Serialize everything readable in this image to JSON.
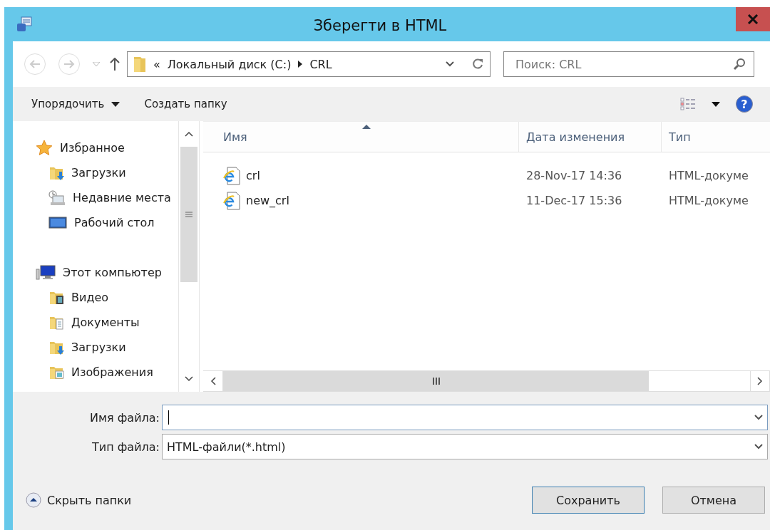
{
  "window": {
    "title": "Зберегти в HTML"
  },
  "address": {
    "overflow": "«",
    "crumbs": [
      "Локальный диск (C:)",
      "CRL"
    ]
  },
  "search": {
    "placeholder": "Поиск: CRL"
  },
  "toolbar": {
    "organize": "Упорядочить",
    "new_folder": "Создать папку",
    "help": "?"
  },
  "nav": [
    {
      "label": "Избранное",
      "kind": "favorites",
      "children": [
        {
          "label": "Загрузки",
          "kind": "downloads"
        },
        {
          "label": "Недавние места",
          "kind": "recent"
        },
        {
          "label": "Рабочий стол",
          "kind": "desktop"
        }
      ]
    },
    {
      "label": "Этот компьютер",
      "kind": "computer",
      "children": [
        {
          "label": "Видео",
          "kind": "video"
        },
        {
          "label": "Документы",
          "kind": "documents"
        },
        {
          "label": "Загрузки",
          "kind": "downloads"
        },
        {
          "label": "Изображения",
          "kind": "pictures"
        }
      ]
    }
  ],
  "table": {
    "columns": [
      "Имя",
      "Дата изменения",
      "Тип"
    ],
    "rows": [
      {
        "name": "crl",
        "date": "28-Nov-17 14:36",
        "type": "HTML-докуме"
      },
      {
        "name": "new_crl",
        "date": "11-Dec-17 15:36",
        "type": "HTML-докуме"
      }
    ]
  },
  "file_name": {
    "label": "Имя файла:"
  },
  "file_type": {
    "label": "Тип файла:",
    "value": "HTML-файли(*.html)"
  },
  "hide_folders": "Скрыть папки",
  "buttons": [
    {
      "label": "Сохранить",
      "default": true
    },
    {
      "label": "Отмена",
      "default": false
    }
  ]
}
